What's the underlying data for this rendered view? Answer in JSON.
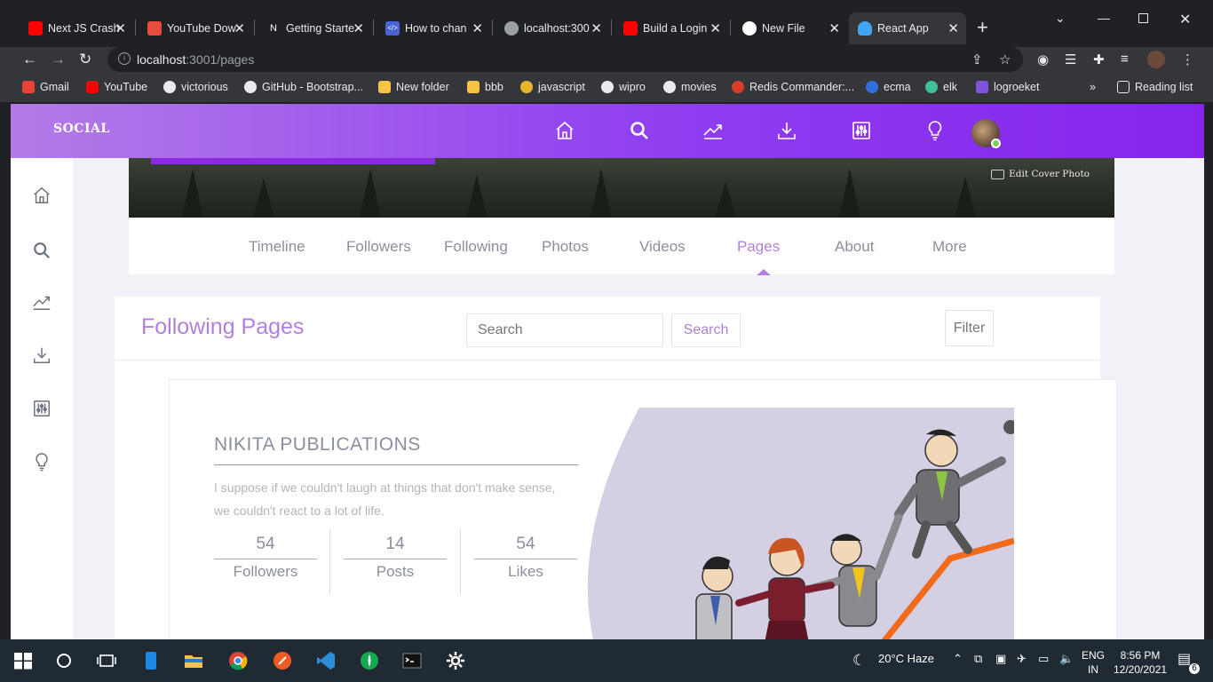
{
  "browser": {
    "tabs": [
      {
        "title": "Next JS Crash",
        "icon": "youtube-icon",
        "color": "#ff0000"
      },
      {
        "title": "YouTube Dow",
        "icon": "download-icon",
        "color": "#e74c3c"
      },
      {
        "title": "Getting Starte",
        "icon": "nextjs-icon",
        "color": "#ffffff"
      },
      {
        "title": "How to chan",
        "icon": "code-icon",
        "color": "#4a63d4"
      },
      {
        "title": "localhost:300",
        "icon": "globe-icon",
        "color": "#9aa0a6"
      },
      {
        "title": "Build a Login",
        "icon": "youtube-icon",
        "color": "#ff0000"
      },
      {
        "title": "New File",
        "icon": "github-icon",
        "color": "#ffffff"
      },
      {
        "title": "React App",
        "icon": "react-icon",
        "color": "#42a5f5"
      }
    ],
    "url_host": "localhost",
    "url_rest": ":3001/pages",
    "bookmarks": [
      {
        "label": "Gmail",
        "color": "#ea4335"
      },
      {
        "label": "YouTube",
        "color": "#ff0000"
      },
      {
        "label": "victorious",
        "color": "#e8eaed"
      },
      {
        "label": "GitHub - Bootstrap...",
        "color": "#e8eaed"
      },
      {
        "label": "New folder",
        "color": "#f6c445"
      },
      {
        "label": "bbb",
        "color": "#f6c445"
      },
      {
        "label": "javascript",
        "color": "#e8b52f"
      },
      {
        "label": "wipro",
        "color": "#e8eaed"
      },
      {
        "label": "movies",
        "color": "#e8eaed"
      },
      {
        "label": "Redis Commander:...",
        "color": "#d83c2b"
      },
      {
        "label": "ecma",
        "color": "#2f6fe0"
      },
      {
        "label": "elk",
        "color": "#3fbf9b"
      },
      {
        "label": "logroeket",
        "color": "#7f52e0"
      }
    ],
    "overflow": "»",
    "reading_list": "Reading list"
  },
  "app": {
    "brand": "SOCIAL",
    "edit_cover": "Edit Cover Photo",
    "profile_tabs": [
      "Timeline",
      "Followers",
      "Following",
      "Photos",
      "Videos",
      "Pages",
      "About",
      "More"
    ],
    "active_tab": "Pages",
    "section_title": "Following Pages",
    "search_placeholder": "Search",
    "search_button": "Search",
    "filter_button": "Filter",
    "page_card": {
      "name": "NIKITA PUBLICATIONS",
      "description": "I suppose if we couldn't laugh at things that don't make sense, we couldn't react to a lot of life.",
      "stats": [
        {
          "value": "54",
          "label": "Followers"
        },
        {
          "value": "14",
          "label": "Posts"
        },
        {
          "value": "54",
          "label": "Likes"
        }
      ]
    },
    "accent": "#b27fe0",
    "nav_gradient": [
      "#b47be8",
      "#8624ec"
    ]
  },
  "taskbar": {
    "weather": "20°C  Haze",
    "lang": "ENG",
    "region": "IN",
    "time": "8:56 PM",
    "date": "12/20/2021",
    "notifications": "6"
  }
}
